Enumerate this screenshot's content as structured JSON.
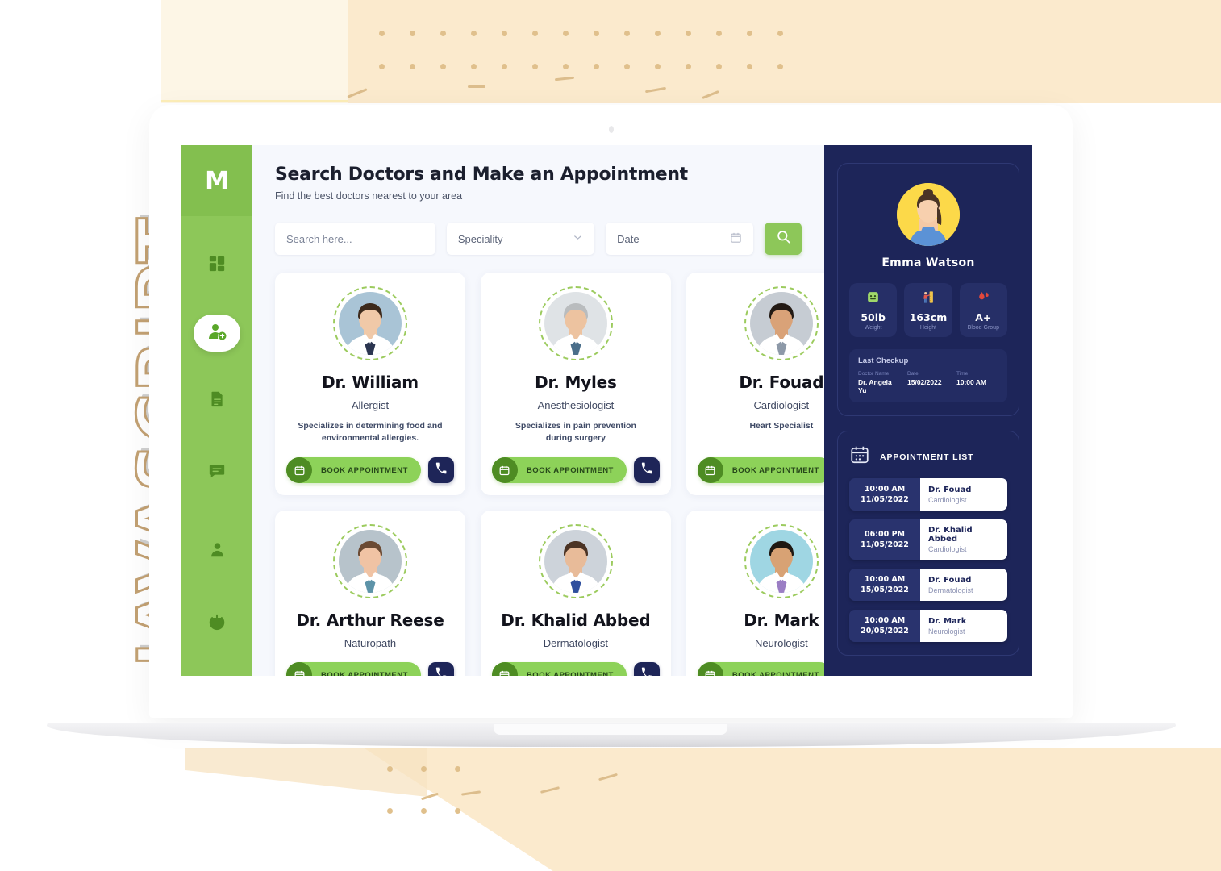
{
  "decor": {
    "side_word": "JAVASCRIPT"
  },
  "sidebar": {
    "logo": "M",
    "items": [
      {
        "name": "dashboard",
        "icon": "grid-icon",
        "active": false
      },
      {
        "name": "add-patient",
        "icon": "user-plus-icon",
        "active": true
      },
      {
        "name": "records",
        "icon": "document-icon",
        "active": false
      },
      {
        "name": "messages",
        "icon": "chat-icon",
        "active": false
      },
      {
        "name": "profile",
        "icon": "person-icon",
        "active": false
      },
      {
        "name": "logout",
        "icon": "power-icon",
        "active": false
      }
    ]
  },
  "header": {
    "title": "Search Doctors and Make an Appointment",
    "subtitle": "Find the best doctors nearest to your area"
  },
  "search": {
    "search_placeholder": "Search here...",
    "speciality_label": "Speciality",
    "date_label": "Date",
    "search_button_icon": "search-icon",
    "dropdown_icon": "chevron-down-icon",
    "calendar_icon": "calendar-icon"
  },
  "doctors": [
    {
      "name": "Dr. William",
      "speciality": "Allergist",
      "description": "Specializes in determining food and environmental allergies.",
      "book_label": "BOOK APPOINTMENT",
      "avatar_bg": "#a9c4d6",
      "skin": "#f0c9a8",
      "hair": "#3d2a1c",
      "coat": "#ffffff",
      "tie": "#2b3550"
    },
    {
      "name": "Dr. Myles",
      "speciality": "Anesthesiologist",
      "description": "Specializes in pain prevention during surgery",
      "book_label": "BOOK APPOINTMENT",
      "avatar_bg": "#dfe3e6",
      "skin": "#edc3a0",
      "hair": "#b9bcbe",
      "coat": "#ffffff",
      "tie": "#4a6e8a"
    },
    {
      "name": "Dr. Fouad",
      "speciality": "Cardiologist",
      "description": "Heart Specialist",
      "book_label": "BOOK APPOINTMENT",
      "avatar_bg": "#c6ccd3",
      "skin": "#d9a278",
      "hair": "#231a14",
      "coat": "#ffffff",
      "tie": "#8d99a8"
    },
    {
      "name": "Dr. Arthur Reese",
      "speciality": "Naturopath",
      "description": "",
      "book_label": "BOOK APPOINTMENT",
      "avatar_bg": "#b7c3cb",
      "skin": "#f0c3a4",
      "hair": "#6b4a33",
      "coat": "#ffffff",
      "tie": "#5d93a8"
    },
    {
      "name": "Dr. Khalid Abbed",
      "speciality": "Dermatologist",
      "description": "",
      "book_label": "BOOK APPOINTMENT",
      "avatar_bg": "#cdd3da",
      "skin": "#e8bb99",
      "hair": "#4b3324",
      "coat": "#ffffff",
      "tie": "#2f4f9e"
    },
    {
      "name": "Dr. Mark",
      "speciality": "Neurologist",
      "description": "",
      "book_label": "BOOK APPOINTMENT",
      "avatar_bg": "#9fd6e3",
      "skin": "#d8a274",
      "hair": "#1e1812",
      "coat": "#ffffff",
      "tie": "#9b7ec4"
    }
  ],
  "patient": {
    "name": "Emma Watson",
    "stats": [
      {
        "icon": "weight-scale-icon",
        "glyph": "⚖",
        "value": "50lb",
        "label": "Weight"
      },
      {
        "icon": "height-ruler-icon",
        "glyph": "↨",
        "value": "163cm",
        "label": "Height"
      },
      {
        "icon": "blood-drop-icon",
        "glyph": "●",
        "value": "A+",
        "label": "Blood Group"
      }
    ],
    "last_checkup": {
      "title": "Last Checkup",
      "doctor_label": "Doctor Name",
      "doctor_value": "Dr. Angela Yu",
      "date_label": "Date",
      "date_value": "15/02/2022",
      "time_label": "Time",
      "time_value": "10:00 AM"
    }
  },
  "appointments": {
    "icon": "appointment-calendar-icon",
    "title": "APPOINTMENT LIST",
    "rows": [
      {
        "time": "10:00 AM",
        "date": "11/05/2022",
        "doctor": "Dr. Fouad",
        "speciality": "Cardiologist"
      },
      {
        "time": "06:00 PM",
        "date": "11/05/2022",
        "doctor": "Dr. Khalid Abbed",
        "speciality": "Cardiologist"
      },
      {
        "time": "10:00 AM",
        "date": "15/05/2022",
        "doctor": "Dr. Fouad",
        "speciality": "Dermatologist"
      },
      {
        "time": "10:00 AM",
        "date": "20/05/2022",
        "doctor": "Dr. Mark",
        "speciality": "Neurologist"
      }
    ]
  },
  "colors": {
    "green": "#8dc759",
    "green_dark": "#4e8c23",
    "navy": "#1d2559",
    "panel_bg": "#f6f8fd",
    "cream": "#fbeacd"
  }
}
